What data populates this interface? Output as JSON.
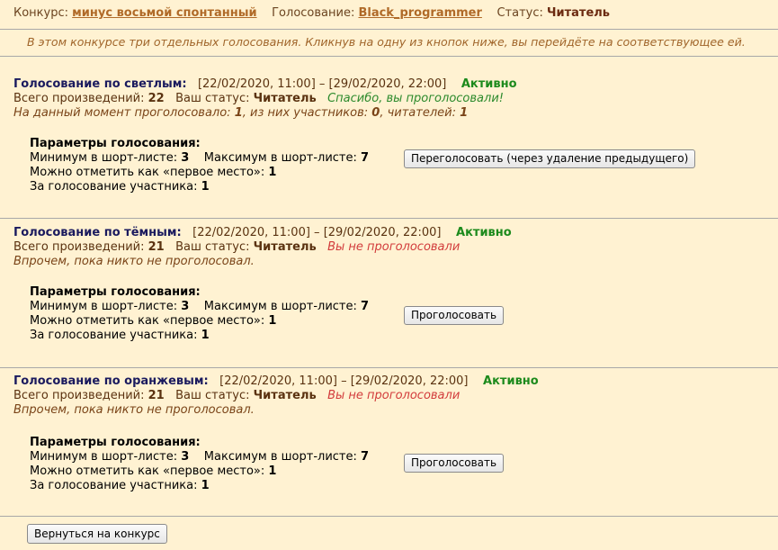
{
  "header": {
    "contest_label": "Конкурс:",
    "contest_name": "минус восьмой спонтанный",
    "voting_label": "Голосование:",
    "voting_user": "Black_programmer",
    "status_label": "Статус:",
    "status_value": "Читатель"
  },
  "intro": "В этом конкурсе три отдельных голосования. Кликнув на одну из кнопок ниже, вы перейдёте на соответствующее ей.",
  "votes": [
    {
      "title": "Голосование по светлым:",
      "dates": "[22/02/2020, 11:00] – [29/02/2020, 22:00]",
      "state": "Активно",
      "works_label": "Всего произведений:",
      "works_count": "22",
      "status_label": "Ваш статус:",
      "status_value": "Читатель",
      "vote_note": "Спасибо, вы проголосовали!",
      "progress_pre": "На данный момент проголосовало:",
      "progress_total": "1",
      "progress_mid1": ", из них участников:",
      "progress_participants": "0",
      "progress_mid2": ", читателей:",
      "progress_readers": "1",
      "params_title": "Параметры голосования:",
      "min_label": "Минимум в шорт-листе:",
      "min_value": "3",
      "max_label": "Максимум в шорт-листе:",
      "max_value": "7",
      "first_label": "Можно отметить как «первое место»:",
      "first_value": "1",
      "part_label": "За голосование участника:",
      "part_value": "1",
      "button": "Переголосовать (через удаление предыдущего)"
    },
    {
      "title": "Голосование по тёмным:",
      "dates": "[22/02/2020, 11:00] – [29/02/2020, 22:00]",
      "state": "Активно",
      "works_label": "Всего произведений:",
      "works_count": "21",
      "status_label": "Ваш статус:",
      "status_value": "Читатель",
      "vote_note": "Вы не проголосовали",
      "progress_text": "Впрочем, пока никто не проголосовал.",
      "params_title": "Параметры голосования:",
      "min_label": "Минимум в шорт-листе:",
      "min_value": "3",
      "max_label": "Максимум в шорт-листе:",
      "max_value": "7",
      "first_label": "Можно отметить как «первое место»:",
      "first_value": "1",
      "part_label": "За голосование участника:",
      "part_value": "1",
      "button": "Проголосовать"
    },
    {
      "title": "Голосование по оранжевым:",
      "dates": "[22/02/2020, 11:00] – [29/02/2020, 22:00]",
      "state": "Активно",
      "works_label": "Всего произведений:",
      "works_count": "21",
      "status_label": "Ваш статус:",
      "status_value": "Читатель",
      "vote_note": "Вы не проголосовали",
      "progress_text": "Впрочем, пока никто не проголосовал.",
      "params_title": "Параметры голосования:",
      "min_label": "Минимум в шорт-листе:",
      "min_value": "3",
      "max_label": "Максимум в шорт-листе:",
      "max_value": "7",
      "first_label": "Можно отметить как «первое место»:",
      "first_value": "1",
      "part_label": "За голосование участника:",
      "part_value": "1",
      "button": "Проголосовать"
    }
  ],
  "back_button": "Вернуться на конкурс"
}
